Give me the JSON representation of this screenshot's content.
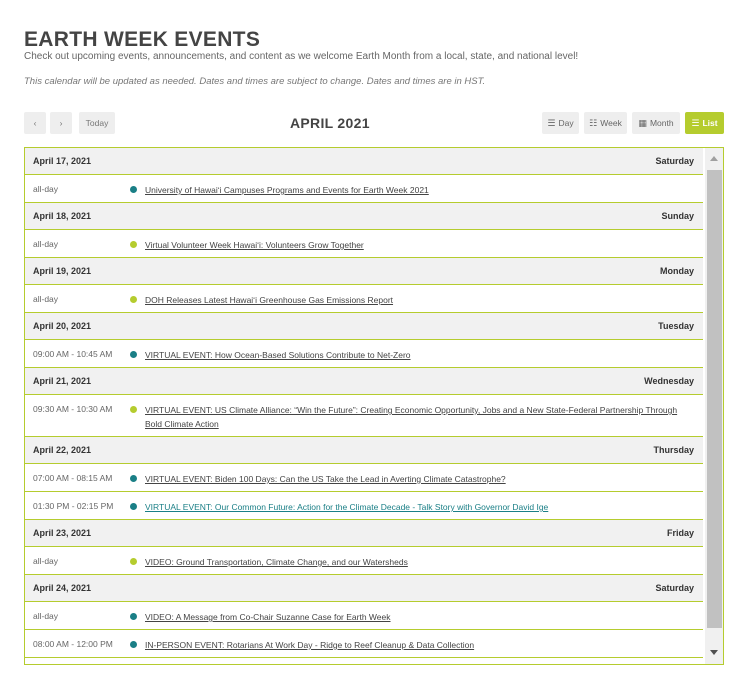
{
  "header": {
    "title": "EARTH WEEK EVENTS",
    "subtitle": "Check out upcoming events, announcements, and content as we welcome Earth Month from a local, state, and national level!",
    "notice": "This calendar will be updated as needed. Dates and times are subject to change. Dates and times are in HST."
  },
  "toolbar": {
    "prev_label": "‹",
    "next_label": "›",
    "today_label": "Today",
    "month_title": "APRIL 2021",
    "views": {
      "day": "Day",
      "week": "Week",
      "month": "Month",
      "list": "List"
    },
    "active_view": "List"
  },
  "colors": {
    "accent_green": "#b5cc2e",
    "dot_teal": "#1a7f86",
    "dot_lime": "#b5cc2e"
  },
  "days": [
    {
      "date": "April 17, 2021",
      "weekday": "Saturday",
      "events": [
        {
          "time": "all-day",
          "dot": "teal",
          "title": "University of Hawaiʻi Campuses Programs and Events for Earth Week 2021"
        }
      ]
    },
    {
      "date": "April 18, 2021",
      "weekday": "Sunday",
      "events": [
        {
          "time": "all-day",
          "dot": "lime",
          "title": "Virtual Volunteer Week Hawaiʻi: Volunteers Grow Together"
        }
      ]
    },
    {
      "date": "April 19, 2021",
      "weekday": "Monday",
      "events": [
        {
          "time": "all-day",
          "dot": "lime",
          "title": "DOH Releases Latest Hawaiʻi Greenhouse Gas Emissions Report"
        }
      ]
    },
    {
      "date": "April 20, 2021",
      "weekday": "Tuesday",
      "events": [
        {
          "time": "09:00 AM - 10:45 AM",
          "dot": "teal",
          "title": "VIRTUAL EVENT: How Ocean-Based Solutions Contribute to Net-Zero"
        }
      ]
    },
    {
      "date": "April 21, 2021",
      "weekday": "Wednesday",
      "events": [
        {
          "time": "09:30 AM - 10:30 AM",
          "dot": "lime",
          "title": "VIRTUAL EVENT: US Climate Alliance: “Win the Future”: Creating Economic Opportunity, Jobs and a New State-Federal Partnership Through Bold Climate Action"
        }
      ]
    },
    {
      "date": "April 22, 2021",
      "weekday": "Thursday",
      "events": [
        {
          "time": "07:00 AM - 08:15 AM",
          "dot": "teal",
          "title": "VIRTUAL EVENT: Biden 100 Days: Can the US Take the Lead in Averting Climate Catastrophe?"
        },
        {
          "time": "01:30 PM - 02:15 PM",
          "dot": "teal",
          "title": "VIRTUAL EVENT: Our Common Future: Action for the Climate Decade - Talk Story with Governor David Ige"
        }
      ]
    },
    {
      "date": "April 23, 2021",
      "weekday": "Friday",
      "events": [
        {
          "time": "all-day",
          "dot": "lime",
          "title": "VIDEO: Ground Transportation, Climate Change, and our Watersheds"
        }
      ]
    },
    {
      "date": "April 24, 2021",
      "weekday": "Saturday",
      "events": [
        {
          "time": "all-day",
          "dot": "teal",
          "title": "VIDEO: A Message from Co-Chair Suzanne Case for Earth Week"
        },
        {
          "time": "08:00 AM - 12:00 PM",
          "dot": "teal",
          "title": "IN-PERSON EVENT: Rotarians At Work Day - Ridge to Reef Cleanup & Data Collection"
        }
      ]
    }
  ]
}
